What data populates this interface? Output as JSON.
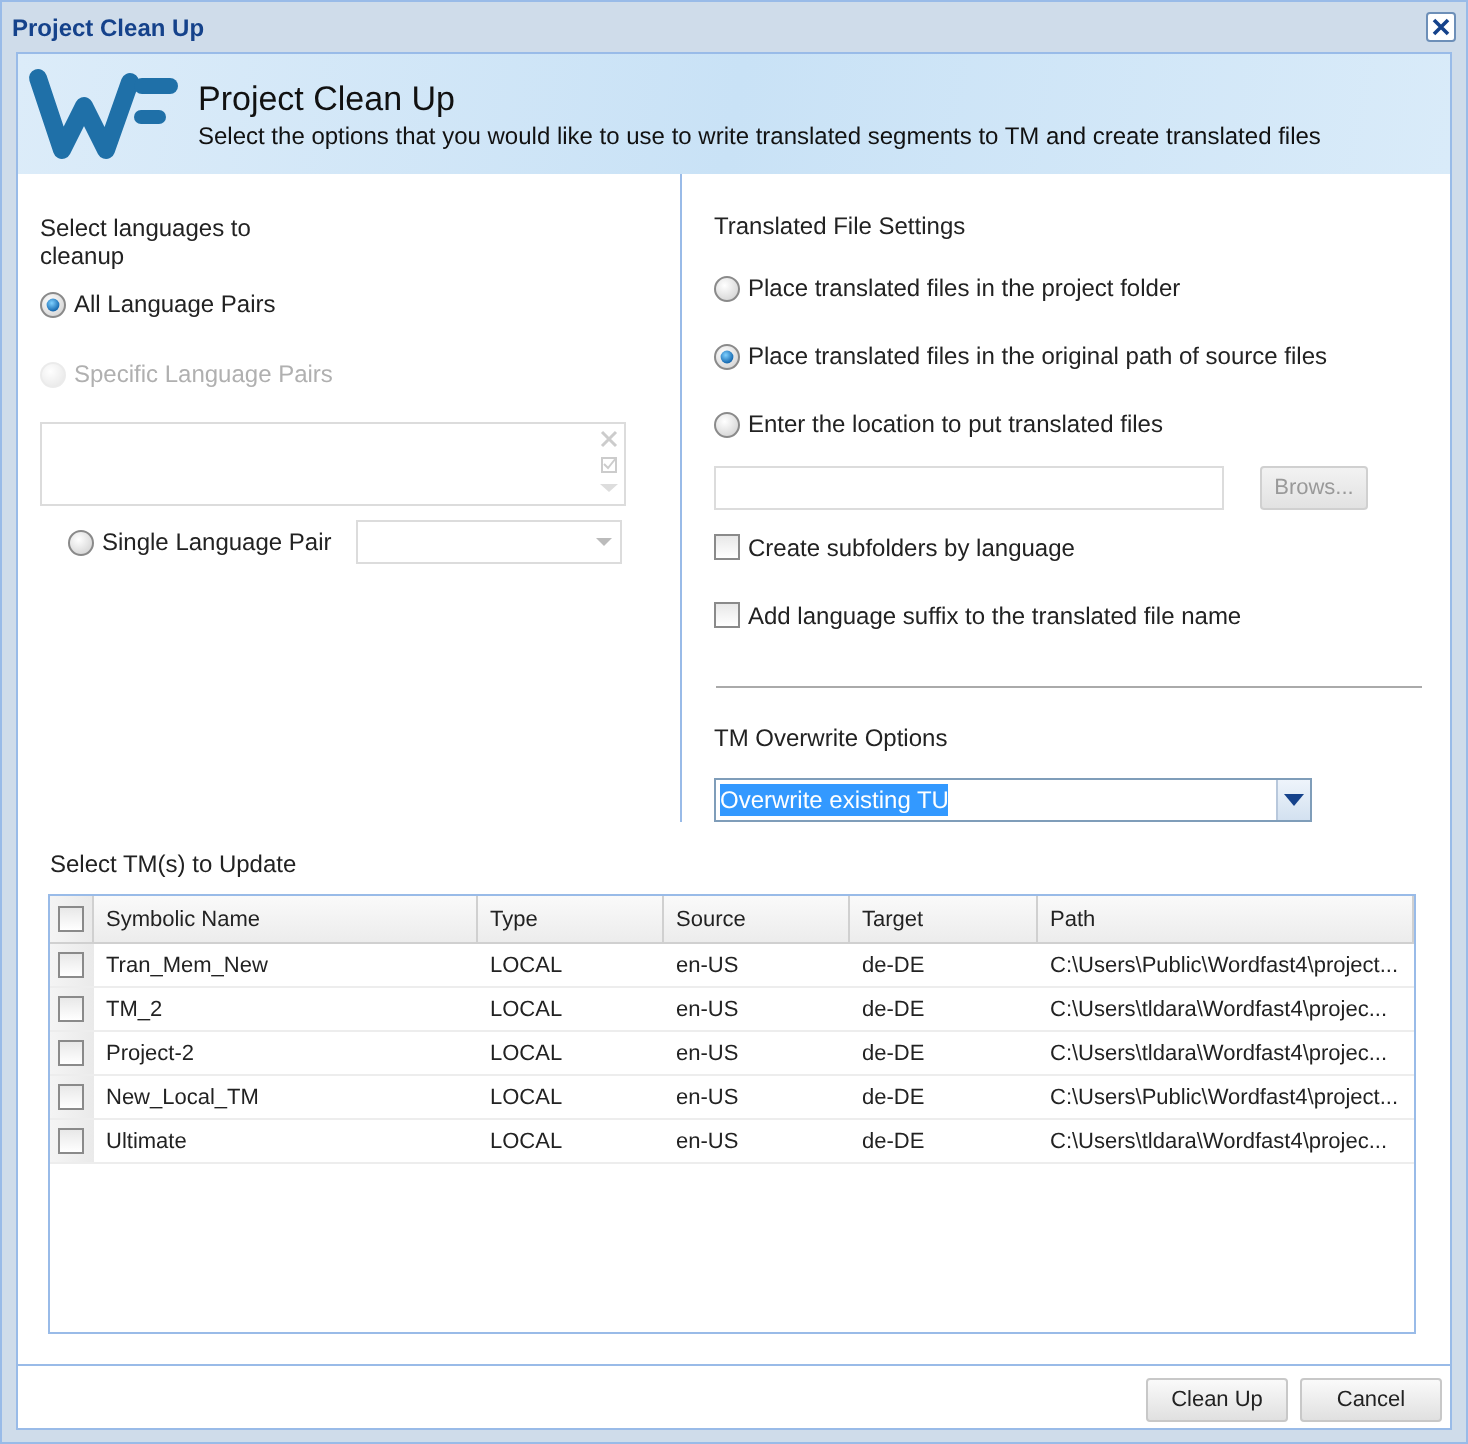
{
  "window": {
    "title": "Project Clean Up"
  },
  "header": {
    "title": "Project Clean Up",
    "subtitle": "Select the options that you would like to use to write translated segments to TM and create translated files"
  },
  "languages": {
    "label": "Select languages to cleanup",
    "options": [
      {
        "label": "All Language Pairs",
        "selected": true,
        "disabled": false
      },
      {
        "label": "Specific Language Pairs",
        "selected": false,
        "disabled": true
      }
    ],
    "single": {
      "label": "Single Language Pair",
      "selected": false
    }
  },
  "file_settings": {
    "title": "Translated File Settings",
    "options": [
      {
        "label": "Place translated files in the project folder",
        "selected": false
      },
      {
        "label": "Place translated files in the original path of source files",
        "selected": true
      },
      {
        "label": "Enter the location to put translated files",
        "selected": false
      }
    ],
    "browse_button": "Brows...",
    "checkboxes": [
      {
        "label": "Create subfolders by language",
        "checked": false
      },
      {
        "label": "Add language suffix to the translated file name",
        "checked": false
      }
    ]
  },
  "tm_overwrite": {
    "label": "TM Overwrite Options",
    "value": "Overwrite existing TU"
  },
  "tm_table": {
    "label": "Select TM(s) to Update",
    "all_checked": false,
    "columns": [
      "Symbolic Name",
      "Type",
      "Source",
      "Target",
      "Path"
    ],
    "rows": [
      {
        "checked": false,
        "cells": [
          "Tran_Mem_New",
          "LOCAL",
          "en-US",
          "de-DE",
          "C:\\Users\\Public\\Wordfast4\\project..."
        ]
      },
      {
        "checked": false,
        "cells": [
          "TM_2",
          "LOCAL",
          "en-US",
          "de-DE",
          "C:\\Users\\tldara\\Wordfast4\\projec..."
        ]
      },
      {
        "checked": false,
        "cells": [
          "Project-2",
          "LOCAL",
          "en-US",
          "de-DE",
          "C:\\Users\\tldara\\Wordfast4\\projec..."
        ]
      },
      {
        "checked": false,
        "cells": [
          "New_Local_TM",
          "LOCAL",
          "en-US",
          "de-DE",
          "C:\\Users\\Public\\Wordfast4\\project..."
        ]
      },
      {
        "checked": false,
        "cells": [
          "Ultimate",
          "LOCAL",
          "en-US",
          "de-DE",
          "C:\\Users\\tldara\\Wordfast4\\projec..."
        ]
      }
    ]
  },
  "buttons": [
    "Clean Up",
    "Cancel"
  ]
}
